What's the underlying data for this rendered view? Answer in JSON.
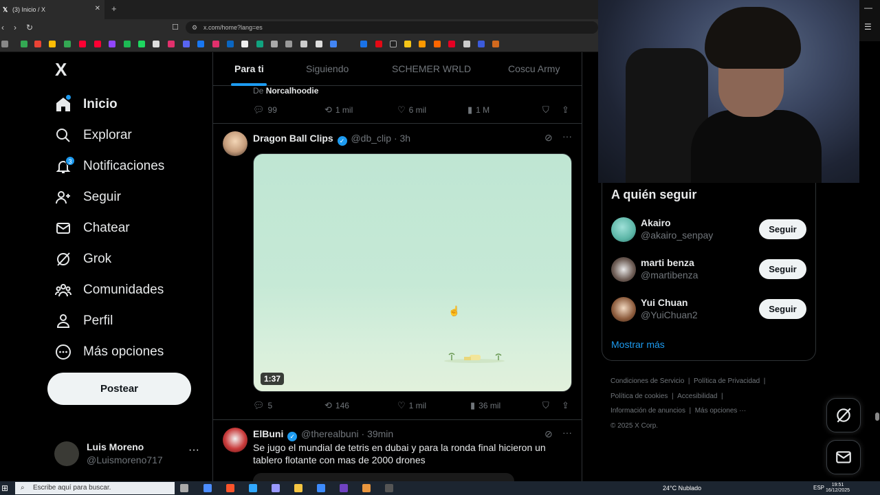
{
  "browser": {
    "tab_title": "(3) Inicio / X",
    "tab_close": "✕",
    "new_tab": "+",
    "url": "x.com/home?lang=es"
  },
  "sidebar": {
    "logo": "X",
    "items": [
      {
        "label": "Inicio",
        "icon": "home-icon"
      },
      {
        "label": "Explorar",
        "icon": "search-icon"
      },
      {
        "label": "Notificaciones",
        "icon": "bell-icon",
        "badge": "3"
      },
      {
        "label": "Seguir",
        "icon": "add-person-icon"
      },
      {
        "label": "Chatear",
        "icon": "mail-icon"
      },
      {
        "label": "Grok",
        "icon": "grok-icon"
      },
      {
        "label": "Comunidades",
        "icon": "people-icon"
      },
      {
        "label": "Perfil",
        "icon": "person-icon"
      },
      {
        "label": "Más opciones",
        "icon": "more-circle-icon"
      }
    ],
    "post_button": "Postear",
    "account": {
      "name": "Luis Moreno",
      "handle": "@Luismoreno717",
      "more": "···"
    }
  },
  "feed": {
    "tabs": [
      "Para ti",
      "Siguiendo",
      "SCHEMER WRLD",
      "Coscu Army"
    ],
    "previous_post": {
      "repost_prefix": "De",
      "repost_user": "Norcalhoodie",
      "replies": "99",
      "reposts": "1 mil",
      "likes": "6 mil",
      "views": "1 M"
    },
    "post1": {
      "name": "Dragon Ball Clips",
      "handle": "@db_clip",
      "time": "· 3h",
      "duration": "1:37",
      "replies": "5",
      "reposts": "146",
      "likes": "1 mil",
      "views": "36 mil"
    },
    "post2": {
      "name": "ElBuni",
      "handle": "@therealbuni",
      "time": "· 39min",
      "text": "Se jugo el mundial de tetris en dubai y para la ronda final hicieron un tablero flotante con mas de 2000 drones"
    }
  },
  "who_to_follow": {
    "title": "A quién seguir",
    "users": [
      {
        "name": "Akairo",
        "handle": "@akairo_senpay",
        "button": "Seguir"
      },
      {
        "name": "marti benza",
        "handle": "@martibenza",
        "button": "Seguir"
      },
      {
        "name": "Yui Chuan",
        "handle": "@YuiChuan2",
        "button": "Seguir"
      }
    ],
    "show_more": "Mostrar más"
  },
  "footer": {
    "links": [
      "Condiciones de Servicio",
      "Política de Privacidad",
      "Política de cookies",
      "Accesibilidad",
      "Información de anuncios",
      "Más opciones ···"
    ],
    "copyright": "© 2025 X Corp."
  },
  "taskbar": {
    "search_placeholder": "Escribe aquí para buscar.",
    "weather": "24°C  Nublado",
    "lang": "ESP",
    "time": "19:51",
    "date": "16/12/2025"
  }
}
